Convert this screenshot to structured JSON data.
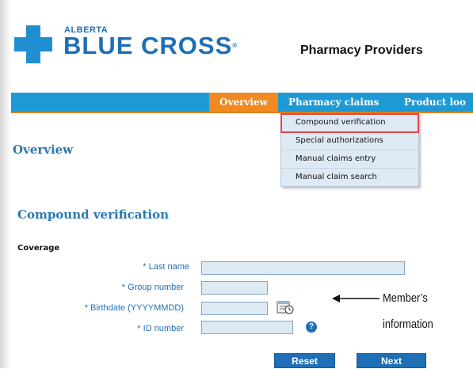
{
  "brand": {
    "top": "ALBERTA",
    "main": "BLUE CROSS",
    "registered": "®",
    "site_title": "Pharmacy Providers"
  },
  "nav": {
    "items": [
      {
        "label": "Overview",
        "active": true
      },
      {
        "label": "Pharmacy claims",
        "active": false
      },
      {
        "label": "Product loo",
        "active": false
      }
    ],
    "dropdown": [
      {
        "label": "Compound verification",
        "highlighted": true
      },
      {
        "label": "Special authorizations",
        "highlighted": false
      },
      {
        "label": "Manual claims entry",
        "highlighted": false
      },
      {
        "label": "Manual claim search",
        "highlighted": false
      }
    ]
  },
  "page": {
    "overview_heading": "Overview",
    "section_heading": "Compound verification",
    "coverage_label": "Coverage"
  },
  "form": {
    "last_name_label": "* Last name",
    "last_name_value": "",
    "group_number_label": "* Group number",
    "group_number_value": "",
    "birthdate_label": "* Birthdate (YYYYMMDD)",
    "birthdate_value": "",
    "id_number_label": "* ID number",
    "id_number_value": "",
    "help_glyph": "?"
  },
  "buttons": {
    "reset": "Reset",
    "next": "Next"
  },
  "annotation": {
    "line1": "Member’s",
    "line2": "information"
  },
  "colors": {
    "brand_blue": "#1f6fb6",
    "nav_blue": "#1d9ad6",
    "active_orange": "#f08a20",
    "highlight_red": "#e0474c",
    "field_fill": "#dde9f3"
  },
  "icons": [
    "cross-logo-icon",
    "calendar-icon",
    "help-icon",
    "arrow-left-icon"
  ]
}
